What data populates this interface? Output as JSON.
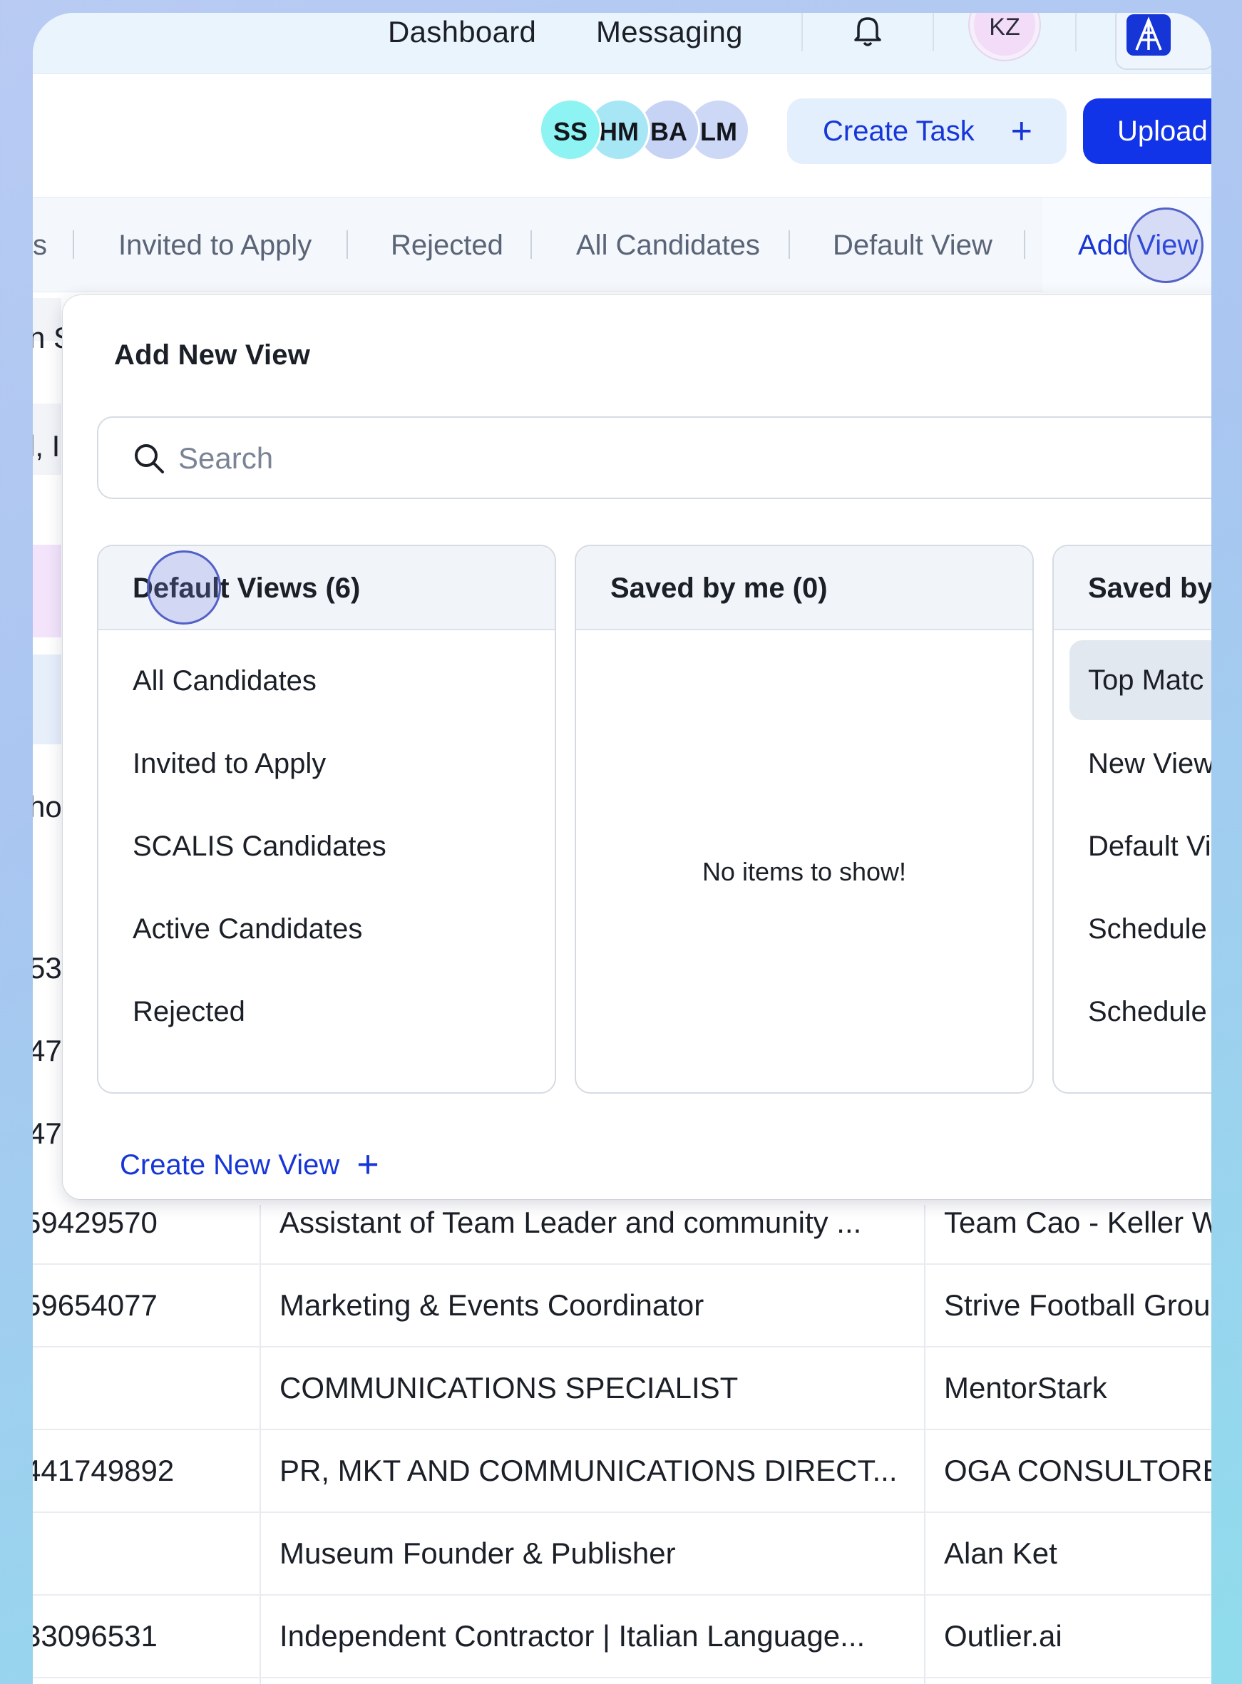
{
  "topnav": {
    "dashboard": "Dashboard",
    "messaging": "Messaging",
    "bell_icon": "bell-icon",
    "user_initials": "KZ",
    "logo_icon": "company-logo-icon"
  },
  "header": {
    "avatars": [
      {
        "initials": "SS",
        "color": "#8ef4f3"
      },
      {
        "initials": "HM",
        "color": "#a7e7f5"
      },
      {
        "initials": "BA",
        "color": "#c7d3f4"
      },
      {
        "initials": "LM",
        "color": "#ccd8f5"
      }
    ],
    "create_task": "Create Task",
    "create_task_plus": "+",
    "upload": "Upload"
  },
  "tabs": {
    "partial": "s",
    "items": [
      "Invited to Apply",
      "Rejected",
      "All Candidates",
      "Default View"
    ],
    "add_view": "Add View"
  },
  "background": {
    "side_texts": [
      "n S",
      "l, In",
      "ho",
      "53",
      "47",
      "47"
    ],
    "rows": [
      {
        "c1": "59429570",
        "c2": "Assistant of Team Leader and community ...",
        "c3": "Team Cao - Keller W"
      },
      {
        "c1": "59654077",
        "c2": "Marketing & Events Coordinator",
        "c3": "Strive Football Group"
      },
      {
        "c1": "",
        "c2": "COMMUNICATIONS SPECIALIST",
        "c3": "MentorStark"
      },
      {
        "c1": "441749892",
        "c2": "PR, MKT AND COMMUNICATIONS DIRECT...",
        "c3": "OGA CONSULTORES"
      },
      {
        "c1": "",
        "c2": "Museum Founder & Publisher",
        "c3": "Alan Ket"
      },
      {
        "c1": "33096531",
        "c2": "Independent Contractor | Italian Language...",
        "c3": "Outlier.ai"
      }
    ]
  },
  "panel": {
    "title": "Add New View",
    "search_placeholder": "Search",
    "cards": [
      {
        "title": "Default Views (6)",
        "items": [
          "All Candidates",
          "Invited to Apply",
          "SCALIS Candidates",
          "Active Candidates",
          "Rejected"
        ]
      },
      {
        "title": "Saved by me (0)",
        "empty": "No items to show!"
      },
      {
        "title": "Saved by",
        "items": [
          "Top Matc",
          "New View",
          "Default Vi",
          "Schedule",
          "Schedule"
        ]
      }
    ],
    "create_new_view": "Create New View",
    "create_new_view_plus": "+"
  },
  "colors": {
    "accent": "#1736d8",
    "upload_bg": "#1234e8"
  }
}
